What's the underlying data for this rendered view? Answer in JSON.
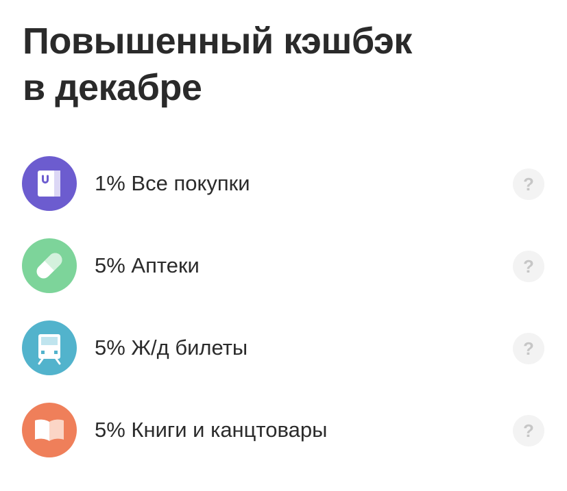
{
  "title": {
    "line1": "Повышенный кэшбэк",
    "line2": "в декабре"
  },
  "colors": {
    "text": "#2b2b2b",
    "help_bg": "#f3f3f3",
    "help_fg": "#c6c6c6"
  },
  "categories": [
    {
      "label": "1% Все покупки",
      "icon": "shopping-bag-icon",
      "color": "#6c5ccf",
      "help": "?"
    },
    {
      "label": "5% Аптеки",
      "icon": "pill-icon",
      "color": "#7dd49a",
      "help": "?"
    },
    {
      "label": "5% Ж/д билеты",
      "icon": "train-icon",
      "color": "#52b3cc",
      "help": "?"
    },
    {
      "label": "5% Книги и канцтовары",
      "icon": "book-icon",
      "color": "#ef7f5a",
      "help": "?"
    }
  ]
}
